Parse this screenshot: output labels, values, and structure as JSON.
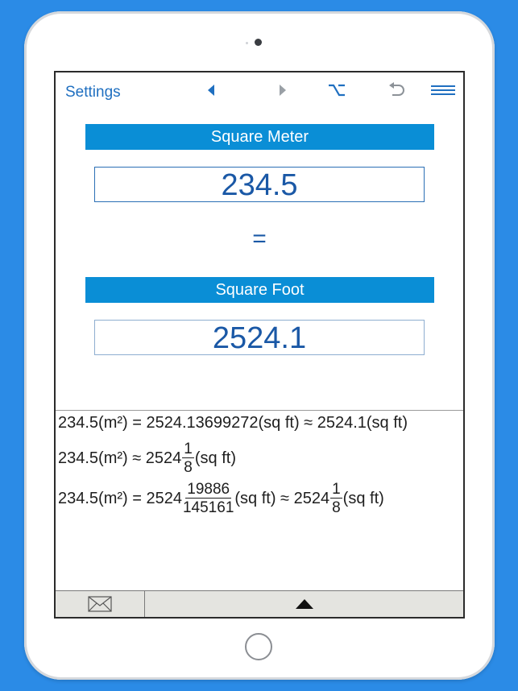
{
  "toolbar": {
    "settings_label": "Settings",
    "icons": [
      "back-arrow-icon",
      "forward-arrow-icon",
      "option-key-icon",
      "undo-icon",
      "menu-icon"
    ]
  },
  "converter": {
    "from_unit": "Square Meter",
    "from_value": "234.5",
    "equals_sign": "=",
    "to_unit": "Square Foot",
    "to_value": "2524.1"
  },
  "results": {
    "line1": "234.5(m²) = 2524.13699272(sq ft) ≈ 2524.1(sq ft)",
    "line2_prefix": "234.5(m²) ≈ 2524",
    "line2_frac_num": "1",
    "line2_frac_den": "8",
    "line2_suffix": "(sq ft)",
    "line3_prefix": "234.5(m²) = 2524",
    "line3_frac_num": "19886",
    "line3_frac_den": "145161",
    "line3_middle": "(sq ft) ≈ 2524",
    "line3_frac2_num": "1",
    "line3_frac2_den": "8",
    "line3_suffix": "(sq ft)"
  },
  "bottom_bar": {
    "icons": [
      "mail-icon",
      "triangle-up-icon"
    ]
  },
  "colors": {
    "background": "#2b8be6",
    "accent": "#0a8ed6",
    "value_text": "#1a58a6",
    "link": "#1f6fc0"
  }
}
